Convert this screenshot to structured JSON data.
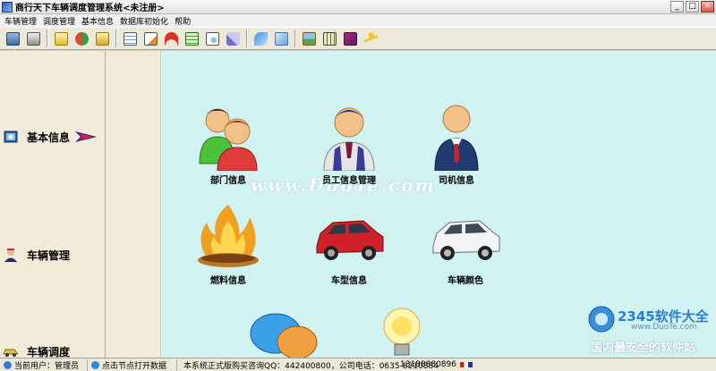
{
  "window": {
    "title": "商行天下车辆调度管理系统<未注册>",
    "buttons": {
      "minimize": "_",
      "maximize": "□",
      "close": "✕"
    }
  },
  "menu": [
    "车辆管理",
    "调度管理",
    "基本信息",
    "数据库初始化",
    "帮助"
  ],
  "toolbar": {
    "groups": [
      [
        "computer-icon",
        "printer-icon"
      ],
      [
        "folder-icon",
        "exchange-icon",
        "open-folder-icon"
      ],
      [
        "notepad-icon",
        "edit-icon",
        "umbrella-icon",
        "ledger-icon",
        "search-doc-icon",
        "brush-icon"
      ],
      [
        "scissors-icon",
        "copy-icon"
      ],
      [
        "picture-icon",
        "calculator-icon",
        "help-book-icon",
        "exit-runner-icon"
      ]
    ]
  },
  "sidebar": {
    "items": [
      {
        "label": "基本信息",
        "icon": "basic-info-icon"
      },
      {
        "label": "车辆管理",
        "icon": "vehicle-management-icon"
      },
      {
        "label": "车辆调度",
        "icon": "vehicle-dispatch-icon"
      }
    ]
  },
  "tiles": [
    {
      "label": "部门信息",
      "icon": "department-people-icon"
    },
    {
      "label": "员工信息管理",
      "icon": "employee-person-icon"
    },
    {
      "label": "司机信息",
      "icon": "driver-person-icon"
    },
    {
      "label": "燃料信息",
      "icon": "fuel-fire-icon"
    },
    {
      "label": "车型信息",
      "icon": "red-car-icon"
    },
    {
      "label": "车辆颜色",
      "icon": "white-car-icon"
    }
  ],
  "watermark": "www.DuoTe.com",
  "corner_logo": {
    "main": "2345软件大全",
    "sub": "www.DuoTe.com",
    "tagline": "国内最安全的软件站"
  },
  "status": {
    "user": "当前用户：管理员",
    "hint": "点击节点打开数据",
    "purchase": "本系统正式版购买咨询QQ：442400800，公司电话：0635-8210884",
    "mobile": "13188880896"
  },
  "colors": {
    "main_bg": "#d0f2f1",
    "sidebar_bg": "#f2ebd7",
    "toolbar_bg": "#ece9d8"
  }
}
